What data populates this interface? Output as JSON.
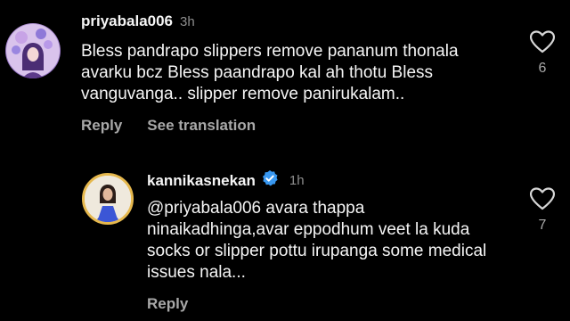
{
  "comments": [
    {
      "username": "priyabala006",
      "time": "3h",
      "text": "Bless pandrapo slippers remove pananum thonala avarku bcz Bless paandrapo kal ah thotu Bless vanguvanga.. slipper remove panirukalam..",
      "likes": "6",
      "reply_label": "Reply",
      "translate_label": "See translation"
    },
    {
      "username": "kannikasnekan",
      "time": "1h",
      "verified": true,
      "text": "@priyabala006 avara thappa ninaikadhinga,avar eppodhum veet la kuda socks or slipper pottu irupanga some medical issues nala...",
      "likes": "7",
      "reply_label": "Reply"
    }
  ],
  "colors": {
    "background": "#000000",
    "text": "#f5f5f5",
    "muted": "#a8a8a8",
    "verified": "#3897f0"
  },
  "icons": [
    "heart-icon",
    "verified-badge-icon"
  ]
}
